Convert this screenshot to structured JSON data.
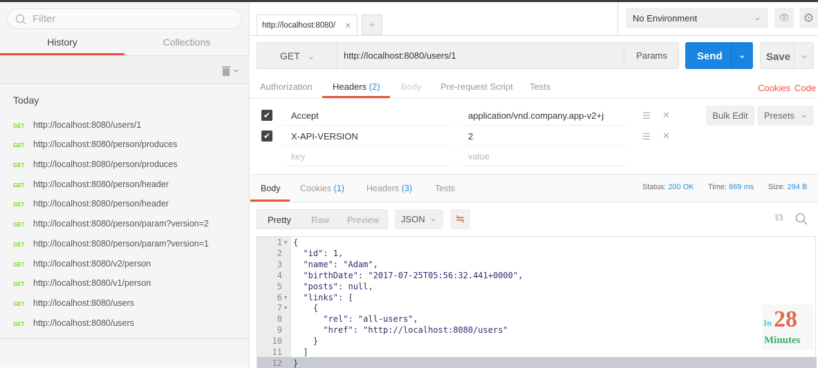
{
  "sidebar": {
    "filter_placeholder": "Filter",
    "tabs": [
      "History",
      "Collections"
    ],
    "section": "Today",
    "history": [
      {
        "method": "GET",
        "url": "http://localhost:8080/users/1"
      },
      {
        "method": "GET",
        "url": "http://localhost:8080/person/produces"
      },
      {
        "method": "GET",
        "url": "http://localhost:8080/person/produces"
      },
      {
        "method": "GET",
        "url": "http://localhost:8080/person/header"
      },
      {
        "method": "GET",
        "url": "http://localhost:8080/person/header"
      },
      {
        "method": "GET",
        "url": "http://localhost:8080/person/param?version=2"
      },
      {
        "method": "GET",
        "url": "http://localhost:8080/person/param?version=1"
      },
      {
        "method": "GET",
        "url": "http://localhost:8080/v2/person"
      },
      {
        "method": "GET",
        "url": "http://localhost:8080/v1/person"
      },
      {
        "method": "GET",
        "url": "http://localhost:8080/users"
      },
      {
        "method": "GET",
        "url": "http://localhost:8080/users"
      }
    ]
  },
  "tab": {
    "title": "http://localhost:8080/"
  },
  "environment": "No Environment",
  "request": {
    "method": "GET",
    "url": "http://localhost:8080/users/1",
    "params": "Params",
    "send": "Send",
    "save": "Save",
    "tabs": {
      "auth": "Authorization",
      "headers": "Headers",
      "headers_count": "(2)",
      "body": "Body",
      "prereq": "Pre-request Script",
      "tests": "Tests"
    },
    "cookies": "Cookies",
    "code": "Code",
    "headers": [
      {
        "key": "Accept",
        "value": "application/vnd.company.app-v2+js",
        "checked": true
      },
      {
        "key": "X-API-VERSION",
        "value": "2",
        "checked": true
      }
    ],
    "key_placeholder": "key",
    "value_placeholder": "value",
    "bulk_edit": "Bulk Edit",
    "presets": "Presets"
  },
  "response": {
    "tabs": {
      "body": "Body",
      "cookies": "Cookies",
      "cookies_count": "(1)",
      "headers": "Headers",
      "headers_count": "(3)",
      "tests": "Tests"
    },
    "status_label": "Status:",
    "status": "200 OK",
    "time_label": "Time:",
    "time": "669 ms",
    "size_label": "Size:",
    "size": "294 B",
    "views": [
      "Pretty",
      "Raw",
      "Preview"
    ],
    "format": "JSON",
    "lines": [
      "{",
      "  \"id\": 1,",
      "  \"name\": \"Adam\",",
      "  \"birthDate\": \"2017-07-25T05:56:32.441+0000\",",
      "  \"posts\": null,",
      "  \"links\": [",
      "    {",
      "      \"rel\": \"all-users\",",
      "      \"href\": \"http://localhost:8080/users\"",
      "    }",
      "  ]",
      "}"
    ]
  },
  "watermark": {
    "in": "In",
    "num": "28",
    "minutes": "Minutes"
  },
  "colors": {
    "accent": "#e8543c",
    "send": "#1a85e0",
    "get": "#7ed321"
  }
}
